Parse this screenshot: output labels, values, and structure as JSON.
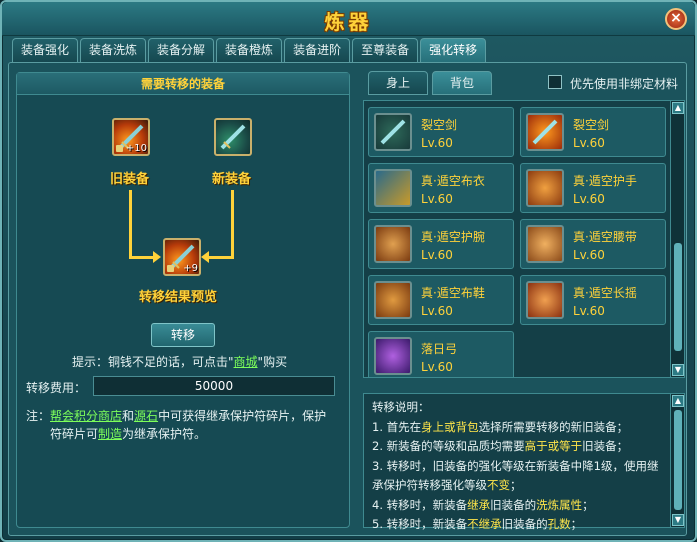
{
  "window": {
    "title": "炼器",
    "close_label": "×"
  },
  "tabs": [
    "装备强化",
    "装备洗炼",
    "装备分解",
    "装备橙炼",
    "装备进阶",
    "至尊装备",
    "强化转移"
  ],
  "left": {
    "header": "需要转移的装备",
    "old_label": "旧装备",
    "old_level": "+10",
    "new_label": "新装备",
    "result_label": "转移结果预览",
    "result_level": "+9",
    "transfer_button": "转移",
    "hint_prefix": "提示：铜钱不足的话，可点击\"",
    "hint_link": "商城",
    "hint_suffix": "\"购买",
    "fee_label": "转移费用：",
    "fee_value": "50000",
    "note_prefix": "注：",
    "note_link1": "帮会积分商店",
    "note_and": "和",
    "note_link2": "源石",
    "note_mid": "中可获得继承保护符碎片，保护",
    "note_line2_a": "符碎片可",
    "note_link3": "制造",
    "note_line2_b": "为继承保护符。"
  },
  "right": {
    "tab_body": "身上",
    "tab_bag": "背包",
    "checkbox_label": "优先使用非绑定材料",
    "items": [
      {
        "name": "裂空剑",
        "level": "Lv.60",
        "icon": "sword-icon"
      },
      {
        "name": "裂空剑",
        "level": "Lv.60",
        "icon": "fire-sword-icon"
      },
      {
        "name": "真·遁空布衣",
        "level": "Lv.60",
        "icon": "robe-icon"
      },
      {
        "name": "真·遁空护手",
        "level": "Lv.60",
        "icon": "gauntlet-icon"
      },
      {
        "name": "真·遁空护腕",
        "level": "Lv.60",
        "icon": "bracer-icon"
      },
      {
        "name": "真·遁空腰带",
        "level": "Lv.60",
        "icon": "belt-icon"
      },
      {
        "name": "真·遁空布鞋",
        "level": "Lv.60",
        "icon": "shoes-icon"
      },
      {
        "name": "真·遁空长摇",
        "level": "Lv.60",
        "icon": "pants-icon"
      },
      {
        "name": "落日弓",
        "level": "Lv.60",
        "icon": "bow-icon"
      }
    ],
    "desc_title": "转移说明：",
    "desc": {
      "l1a": "1. 首先在",
      "l1b": "身上或背包",
      "l1c": "选择所需要转移的新旧装备；",
      "l2a": "2. 新装备的等级和品质均需要",
      "l2b": "高于或等于",
      "l2c": "旧装备；",
      "l3a": "3. 转移时，旧装备的强化等级在新装备中降1级，使用继",
      "l3b": "承保护符转移强化等级",
      "l3c": "不变",
      "l3d": "；",
      "l4a": "4. 转移时，新装备",
      "l4b": "继承",
      "l4c": "旧装备的",
      "l4d": "洗炼属性",
      "l4e": "；",
      "l5a": "5. 转移时，新装备",
      "l5b": "不继承",
      "l5c": "旧装备的",
      "l5d": "孔数",
      "l5e": "；"
    }
  },
  "colors": {
    "accent": "#ffd23a",
    "link": "#7dff5a",
    "panel": "#164a53"
  }
}
